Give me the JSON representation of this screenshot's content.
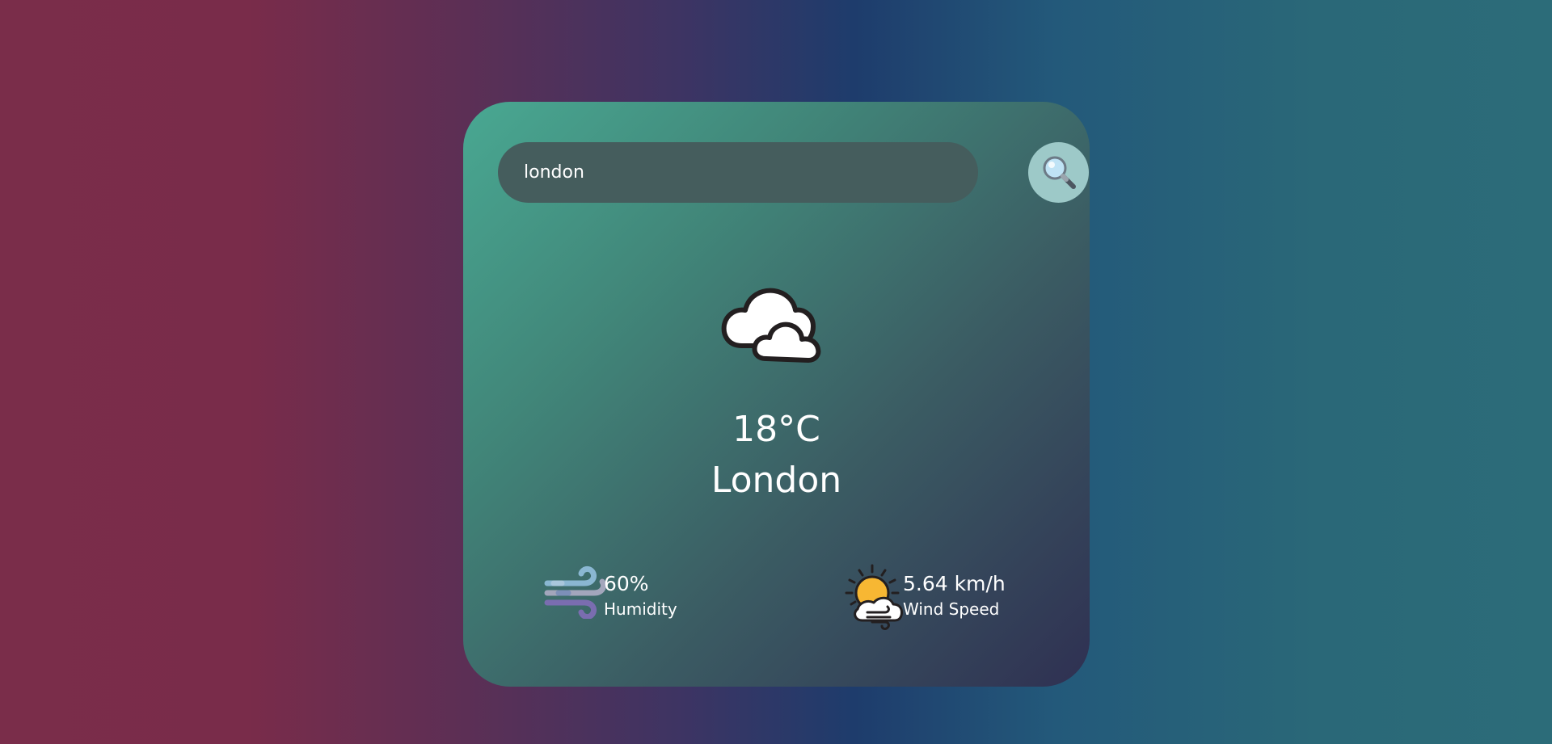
{
  "search": {
    "value": "london",
    "icon": "magnifier-icon"
  },
  "weather": {
    "icon": "clouds-icon",
    "temperature": "18°C",
    "city": "London"
  },
  "details": {
    "humidity": {
      "icon": "humidity-wind-icon",
      "value": "60%",
      "label": "Humidity"
    },
    "wind": {
      "icon": "sun-cloud-wind-icon",
      "value": "5.64 km/h",
      "label": "Wind Speed"
    }
  },
  "colors": {
    "card_start": "#49a892",
    "card_end": "#2f3052",
    "input_bg": "#455d5d",
    "button_bg": "#9dc9c8",
    "text": "#ffffff"
  }
}
